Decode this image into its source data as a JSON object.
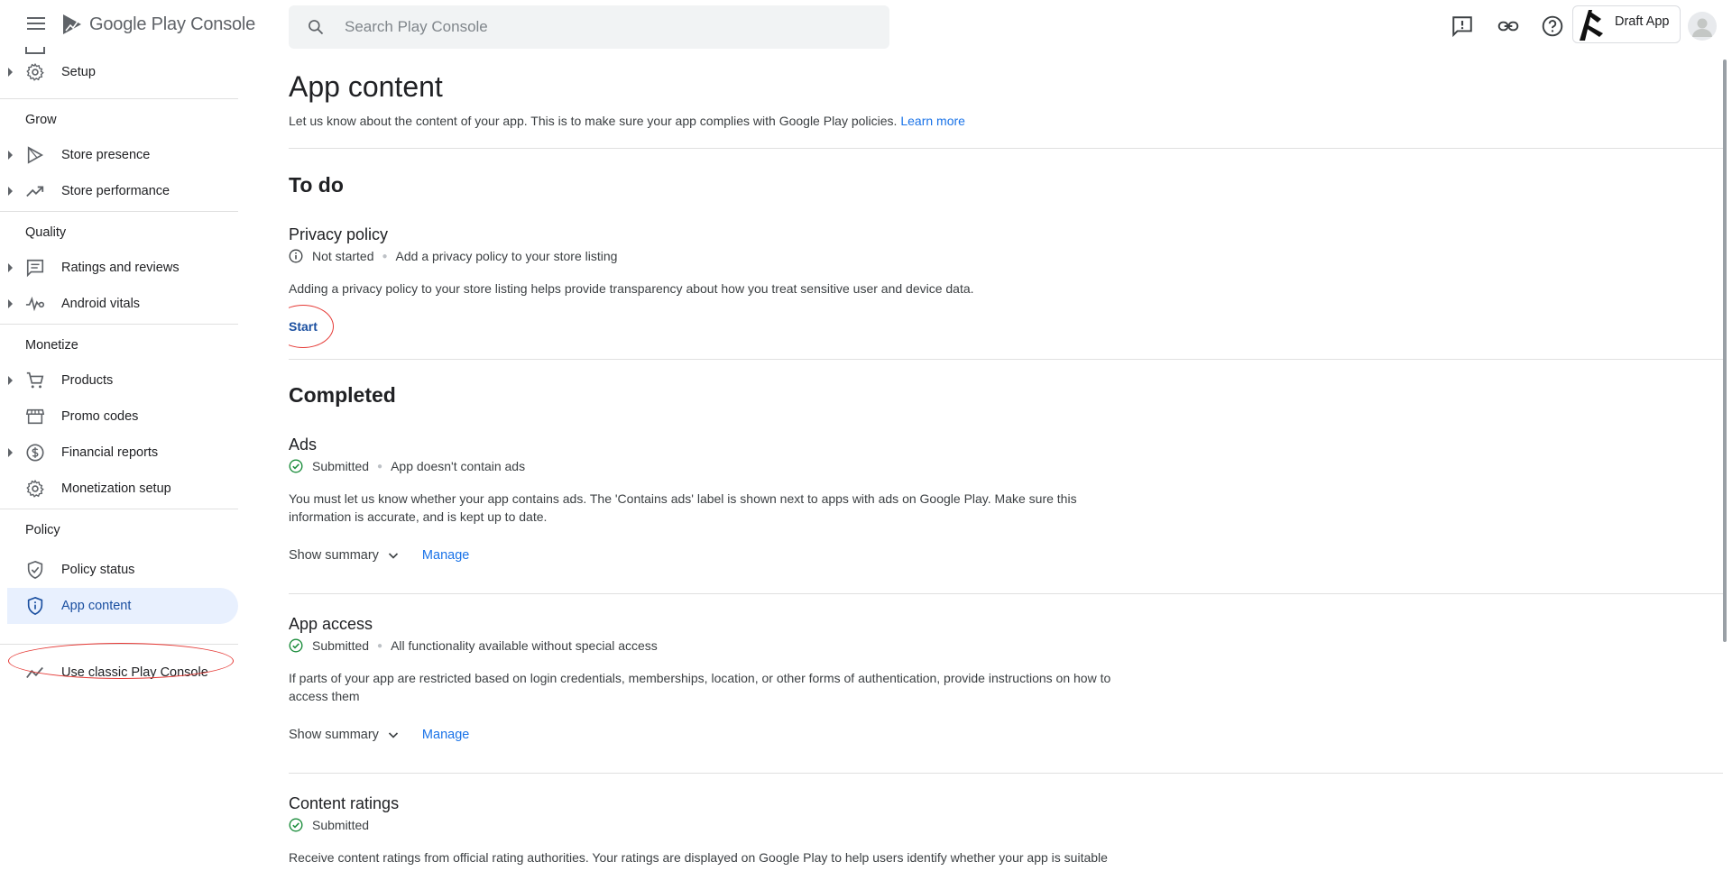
{
  "header": {
    "app_title": "Google Play Console",
    "search_placeholder": "Search Play Console",
    "app_name": "Draft App"
  },
  "sidebar": {
    "items_top": [
      {
        "label": "Setup"
      }
    ],
    "sections": [
      {
        "title": "Grow",
        "items": [
          {
            "label": "Store presence"
          },
          {
            "label": "Store performance"
          }
        ]
      },
      {
        "title": "Quality",
        "items": [
          {
            "label": "Ratings and reviews"
          },
          {
            "label": "Android vitals"
          }
        ]
      },
      {
        "title": "Monetize",
        "items": [
          {
            "label": "Products"
          },
          {
            "label": "Promo codes"
          },
          {
            "label": "Financial reports"
          },
          {
            "label": "Monetization setup"
          }
        ]
      },
      {
        "title": "Policy",
        "items": [
          {
            "label": "Policy status"
          },
          {
            "label": "App content"
          }
        ]
      }
    ],
    "classic_label": "Use classic Play Console"
  },
  "main": {
    "title": "App content",
    "description": "Let us know about the content of your app. This is to make sure your app complies with Google Play policies.",
    "learn_more": "Learn more",
    "todo": {
      "heading": "To do",
      "privacy": {
        "title": "Privacy policy",
        "status": "Not started",
        "status_detail": "Add a privacy policy to your store listing",
        "description": "Adding a privacy policy to your store listing helps provide transparency about how you treat sensitive user and device data.",
        "action": "Start"
      }
    },
    "completed": {
      "heading": "Completed",
      "ads": {
        "title": "Ads",
        "status": "Submitted",
        "status_detail": "App doesn't contain ads",
        "description": "You must let us know whether your app contains ads. The 'Contains ads' label is shown next to apps with ads on Google Play. Make sure this information is accurate, and is kept up to date."
      },
      "app_access": {
        "title": "App access",
        "status": "Submitted",
        "status_detail": "All functionality available without special access",
        "description": "If parts of your app are restricted based on login credentials, memberships, location, or other forms of authentication, provide instructions on how to access them"
      },
      "content_ratings": {
        "title": "Content ratings",
        "status": "Submitted",
        "description": "Receive content ratings from official rating authorities. Your ratings are displayed on Google Play to help users identify whether your app is suitable for them."
      },
      "show_summary": "Show summary",
      "manage": "Manage"
    }
  },
  "colors": {
    "accent": "#1a73e8",
    "active_bg": "#e8f0fe",
    "success": "#1e8e3e",
    "annotation": "#e53935"
  }
}
